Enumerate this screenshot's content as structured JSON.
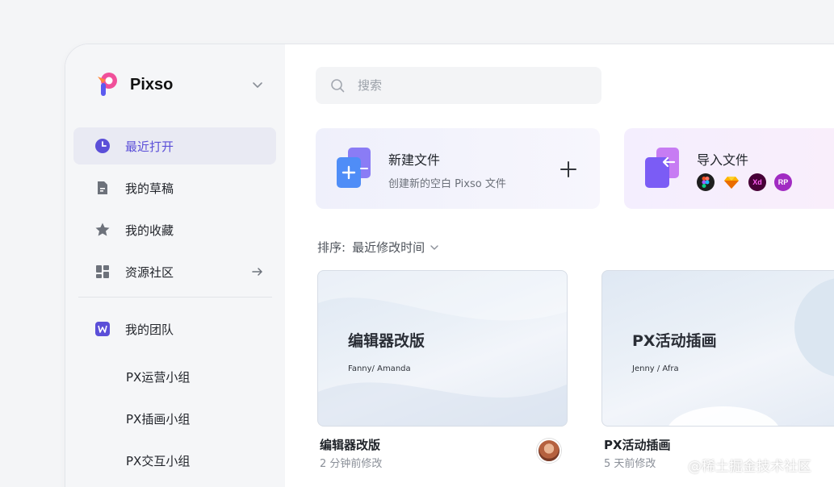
{
  "brand": {
    "name": "Pixso"
  },
  "sidebar": {
    "items": [
      {
        "label": "最近打开",
        "icon": "clock-icon"
      },
      {
        "label": "我的草稿",
        "icon": "draft-icon"
      },
      {
        "label": "我的收藏",
        "icon": "star-icon"
      },
      {
        "label": "资源社区",
        "icon": "grid-icon"
      }
    ],
    "team": {
      "label": "我的团队",
      "icon": "team-icon"
    },
    "groups": [
      "PX运营小组",
      "PX插画小组",
      "PX交互小组"
    ]
  },
  "search": {
    "placeholder": "搜索"
  },
  "actions": {
    "new_file": {
      "title": "新建文件",
      "subtitle": "创建新的空白 Pixso 文件"
    },
    "import_file": {
      "title": "导入文件",
      "formats": [
        "Figma",
        "Sketch",
        "Xd",
        "RP"
      ]
    }
  },
  "sort": {
    "label": "排序:",
    "value": "最近修改时间"
  },
  "files": [
    {
      "thumb_title": "编辑器改版",
      "thumb_authors": "Fanny/ Amanda",
      "name": "编辑器改版",
      "modified": "2 分钟前修改"
    },
    {
      "thumb_title": "PX活动插画",
      "thumb_authors": "Jenny / Afra",
      "name": "PX活动插画",
      "modified": "5 天前修改"
    }
  ],
  "watermark": "@稀土掘金技术社区",
  "colors": {
    "accent": "#5b4fd8",
    "active_bg": "#e9eaf3",
    "sidebar_bg": "#f5f6f8"
  }
}
